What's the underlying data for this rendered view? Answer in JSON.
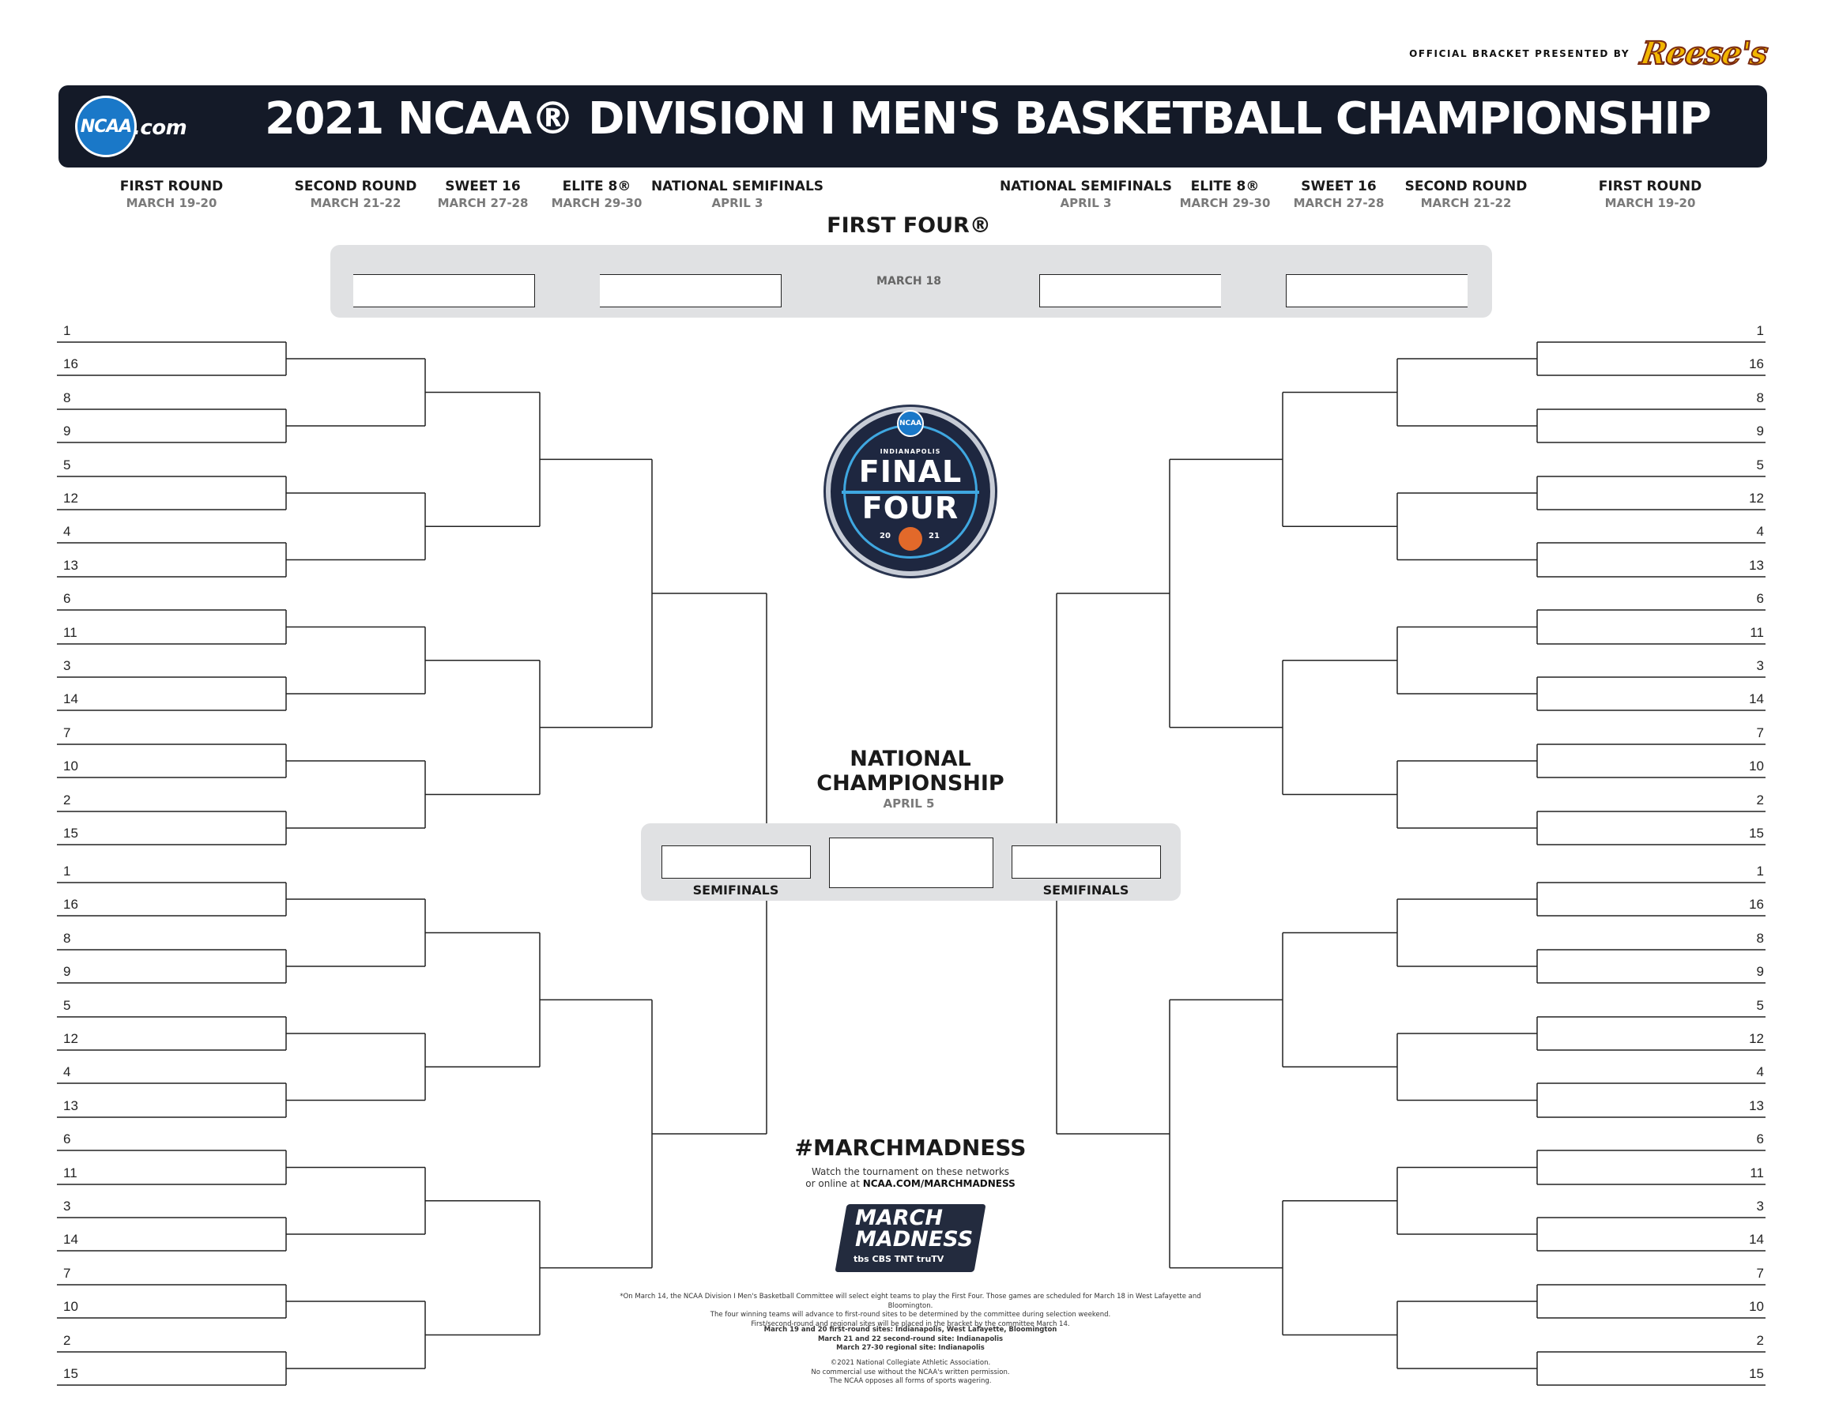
{
  "sponsor": {
    "text": "OFFICIAL BRACKET PRESENTED BY",
    "brand": "Reese's"
  },
  "header": {
    "logo": "NCAA",
    "logo_suffix": ".com",
    "title": "2021 NCAA® DIVISION I MEN'S BASKETBALL CHAMPIONSHIP",
    "bg_color": "#141a28"
  },
  "rounds_left": [
    {
      "name": "FIRST ROUND",
      "date": "MARCH 19-20"
    },
    {
      "name": "SECOND ROUND",
      "date": "MARCH 21-22"
    },
    {
      "name": "SWEET 16",
      "date": "MARCH 27-28"
    },
    {
      "name": "ELITE 8®",
      "date": "MARCH 29-30"
    },
    {
      "name": "NATIONAL SEMIFINALS",
      "date": "APRIL 3"
    }
  ],
  "rounds_right": [
    {
      "name": "NATIONAL SEMIFINALS",
      "date": "APRIL 3"
    },
    {
      "name": "ELITE 8®",
      "date": "MARCH 29-30"
    },
    {
      "name": "SWEET 16",
      "date": "MARCH 27-28"
    },
    {
      "name": "SECOND ROUND",
      "date": "MARCH 21-22"
    },
    {
      "name": "FIRST ROUND",
      "date": "MARCH 19-20"
    }
  ],
  "first_four": {
    "title": "FIRST FOUR®",
    "date": "MARCH 18"
  },
  "seeds": [
    "1",
    "16",
    "8",
    "9",
    "5",
    "12",
    "4",
    "13",
    "6",
    "11",
    "3",
    "14",
    "7",
    "10",
    "2",
    "15"
  ],
  "final_four_logo": {
    "org": "NCAA",
    "city": "INDIANAPOLIS",
    "word1": "FINAL",
    "word2": "FOUR",
    "year_a": "20",
    "year_b": "21"
  },
  "championship": {
    "title_line1": "NATIONAL",
    "title_line2": "CHAMPIONSHIP",
    "date": "APRIL 5",
    "semi_left": "SEMIFINALS",
    "semi_right": "SEMIFINALS"
  },
  "promo": {
    "hashtag": "#MARCHMADNESS",
    "watch_line1": "Watch the tournament on these networks",
    "watch_line2_prefix": "or online at",
    "watch_url": "NCAA.COM/MARCHMADNESS",
    "logo_line1": "MARCH",
    "logo_line2": "MADNESS",
    "networks": "tbs  CBS  TNT  truTV"
  },
  "footnotes": {
    "p1": [
      "*On March 14, the NCAA Division I Men's Basketball Committee will select eight teams to play the First Four. Those games are scheduled for March 18 in West Lafayette and Bloomington.",
      "The four winning teams will advance to first-round sites to be determined by the committee during selection weekend.",
      "First/second-round and regional sites will be placed in the bracket by the committee March 14."
    ],
    "p2": [
      "March 19 and 20 first-round sites: Indianapolis, West Lafayette, Bloomington",
      "March 21 and 22 second-round site: Indianapolis",
      "March 27-30 regional site: Indianapolis"
    ],
    "p3": [
      "©2021 National Collegiate Athletic Association.",
      "No commercial use without the NCAA's written permission.",
      "The NCAA opposes all forms of sports wagering."
    ]
  }
}
